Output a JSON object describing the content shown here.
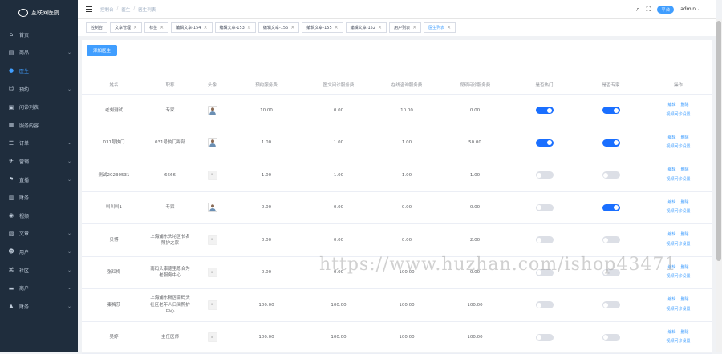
{
  "app": {
    "logo_text": "互联网医院"
  },
  "sidebar": {
    "items": [
      {
        "label": "首页",
        "icon": "home-icon",
        "glyph": "⌂",
        "active": false,
        "chevron": false
      },
      {
        "label": "商品",
        "icon": "goods-icon",
        "glyph": "▤",
        "active": false,
        "chevron": true
      },
      {
        "label": "医生",
        "icon": "doctor-icon",
        "glyph": "●",
        "active": true,
        "chevron": false
      },
      {
        "label": "预约",
        "icon": "appointment-icon",
        "glyph": "☺",
        "active": false,
        "chevron": true
      },
      {
        "label": "问诊列表",
        "icon": "consult-icon",
        "glyph": "▣",
        "active": false,
        "chevron": false
      },
      {
        "label": "服务内容",
        "icon": "service-icon",
        "glyph": "▦",
        "active": false,
        "chevron": false
      },
      {
        "label": "订单",
        "icon": "order-icon",
        "glyph": "☰",
        "active": false,
        "chevron": true
      },
      {
        "label": "营销",
        "icon": "marketing-icon",
        "glyph": "✈",
        "active": false,
        "chevron": true
      },
      {
        "label": "直播",
        "icon": "live-icon",
        "glyph": "⚑",
        "active": false,
        "chevron": true
      },
      {
        "label": "财务",
        "icon": "finance-icon",
        "glyph": "▥",
        "active": false,
        "chevron": false
      },
      {
        "label": "视频",
        "icon": "video-icon",
        "glyph": "◉",
        "active": false,
        "chevron": false
      },
      {
        "label": "文章",
        "icon": "article-icon",
        "glyph": "▧",
        "active": false,
        "chevron": true
      },
      {
        "label": "用户",
        "icon": "user-icon",
        "glyph": "☻",
        "active": false,
        "chevron": true
      },
      {
        "label": "社区",
        "icon": "community-icon",
        "glyph": "⌘",
        "active": false,
        "chevron": true
      },
      {
        "label": "商户",
        "icon": "merchant-icon",
        "glyph": "▬",
        "active": false,
        "chevron": true
      },
      {
        "label": "财务",
        "icon": "finance2-icon",
        "glyph": "▲",
        "active": false,
        "chevron": true
      }
    ]
  },
  "header": {
    "breadcrumb": [
      "控制台",
      "医生",
      "医生列表"
    ],
    "platform_badge": "平台",
    "user": "admin"
  },
  "tags": [
    {
      "label": "控制台",
      "closable": false,
      "active": false
    },
    {
      "label": "文章管理",
      "closable": true,
      "active": false
    },
    {
      "label": "标签",
      "closable": true,
      "active": false
    },
    {
      "label": "编辑文章-154",
      "closable": true,
      "active": false
    },
    {
      "label": "编辑文章-153",
      "closable": true,
      "active": false
    },
    {
      "label": "编辑文章-156",
      "closable": true,
      "active": false
    },
    {
      "label": "编辑文章-155",
      "closable": true,
      "active": false
    },
    {
      "label": "编辑文章-152",
      "closable": true,
      "active": false
    },
    {
      "label": "用户列表",
      "closable": true,
      "active": false
    },
    {
      "label": "医生列表",
      "closable": true,
      "active": true
    }
  ],
  "toolbar": {
    "add_label": "添加医生"
  },
  "table": {
    "columns": [
      "姓名",
      "职称",
      "头像",
      "预约服务费",
      "图文问诊服务费",
      "在线咨询服务费",
      "视频问诊服务费",
      "是否热门",
      "是否专家",
      "操作"
    ],
    "ops": {
      "edit": "编辑",
      "delete": "删除",
      "schedule": "视频问诊设置"
    },
    "rows": [
      {
        "name": "老刘测试",
        "title": "专家",
        "avatar": "person",
        "f1": "10.00",
        "f2": "0.00",
        "f3": "10.00",
        "f4": "0.00",
        "hot": true,
        "expert": true
      },
      {
        "name": "031号执门",
        "title": "031号执门副部",
        "avatar": "person",
        "f1": "1.00",
        "f2": "1.00",
        "f3": "1.00",
        "f4": "50.00",
        "hot": true,
        "expert": true
      },
      {
        "name": "测试20230531",
        "title": "6666",
        "avatar": "placeholder",
        "f1": "1.00",
        "f2": "1.00",
        "f3": "1.00",
        "f4": "1.00",
        "hot": false,
        "expert": false
      },
      {
        "name": "叫叫叫1",
        "title": "专家",
        "avatar": "person",
        "f1": "0.00",
        "f2": "0.00",
        "f3": "0.00",
        "f4": "0.00",
        "hot": false,
        "expert": true
      },
      {
        "name": "贝博",
        "title": "上海浦东头坨区长名照护之家",
        "avatar": "placeholder",
        "f1": "0.00",
        "f2": "0.00",
        "f3": "0.00",
        "f4": "2.00",
        "hot": false,
        "expert": false
      },
      {
        "name": "张红梅",
        "title": "南码头康德里愿合为老服务中心",
        "avatar": "placeholder",
        "f1": "0.00",
        "f2": "0.00",
        "f3": "100.00",
        "f4": "0.00",
        "hot": false,
        "expert": false
      },
      {
        "name": "秦梅莎",
        "title": "上海浦东新区南码头社区老年人日间照护中心",
        "avatar": "placeholder",
        "f1": "100.00",
        "f2": "100.00",
        "f3": "100.00",
        "f4": "100.00",
        "hot": false,
        "expert": false
      },
      {
        "name": "吴婷",
        "title": "主任医师",
        "avatar": "placeholder",
        "f1": "100.00",
        "f2": "100.00",
        "f3": "100.00",
        "f4": "100.00",
        "hot": false,
        "expert": false
      }
    ]
  },
  "watermark": "https://www.huzhan.com/ishop43471"
}
